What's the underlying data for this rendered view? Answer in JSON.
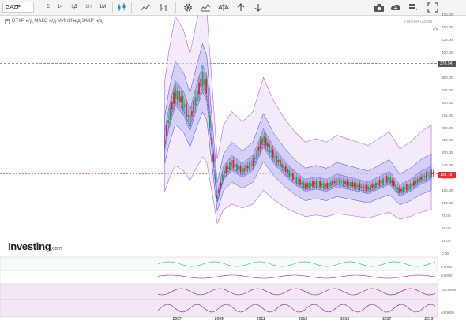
{
  "toolbar": {
    "symbol": "GAZP",
    "timeframes": [
      "5",
      "1ч",
      "1Д",
      "1Н",
      "1М"
    ],
    "active_timeframe": "1Н",
    "icons": [
      "candlestick-icon",
      "indicators-icon",
      "bar-chart-icon",
      "settings-icon",
      "area-icon",
      "balance-icon",
      "undo-icon",
      "redo-icon",
      "camera-icon",
      "cloud-save-icon",
      "grid-icon",
      "fullscreen-icon"
    ]
  },
  "legend": {
    "text": "ОТКР н/д  МАКС н/д  МИНИ н/д  ЗАКР н/д",
    "market_status": "• Market Closed"
  },
  "price_axis": {
    "ticks": [
      "475.00",
      "450.00",
      "425.00",
      "400.00",
      "375.00",
      "350.00",
      "325.00",
      "300.00",
      "275.00",
      "250.00",
      "225.00",
      "200.00",
      "175.00",
      "150.00",
      "125.00",
      "100.00",
      "75.00",
      "50.00",
      "25.00",
      "0.00"
    ],
    "reference_label": "378.54",
    "current_label": "158.79"
  },
  "indicator_axis": {
    "panel1_label": "0.0000",
    "panel2_label": "0.0000",
    "panel3_label": "100.0000",
    "panel4_label": "40.0000"
  },
  "x_axis": [
    "2007",
    "2009",
    "2011",
    "2013",
    "2015",
    "2017",
    "2019"
  ],
  "brand": {
    "name": "Investing",
    "suffix": ".com"
  },
  "colors": {
    "up": "#2e9e4d",
    "down": "#c62f2f",
    "band": "#4a4ad6",
    "envelope": "#b06ad8",
    "current": "#e03030",
    "reference_line": "#555555"
  },
  "chart_data": {
    "type": "candlestick",
    "x_range": [
      2006,
      2019.4
    ],
    "y_range": [
      0,
      475
    ],
    "reference_price": 378.54,
    "current_price": 158.79,
    "approx_close_series": [
      {
        "x": 2006.4,
        "y": 225
      },
      {
        "x": 2006.6,
        "y": 270
      },
      {
        "x": 2006.9,
        "y": 320
      },
      {
        "x": 2007.3,
        "y": 300
      },
      {
        "x": 2007.6,
        "y": 265
      },
      {
        "x": 2007.9,
        "y": 310
      },
      {
        "x": 2008.2,
        "y": 350
      },
      {
        "x": 2008.4,
        "y": 330
      },
      {
        "x": 2008.7,
        "y": 200
      },
      {
        "x": 2008.9,
        "y": 110
      },
      {
        "x": 2009.2,
        "y": 160
      },
      {
        "x": 2009.6,
        "y": 180
      },
      {
        "x": 2010.1,
        "y": 165
      },
      {
        "x": 2010.6,
        "y": 180
      },
      {
        "x": 2011.1,
        "y": 230
      },
      {
        "x": 2011.6,
        "y": 195
      },
      {
        "x": 2012.1,
        "y": 170
      },
      {
        "x": 2012.6,
        "y": 150
      },
      {
        "x": 2013.1,
        "y": 135
      },
      {
        "x": 2013.6,
        "y": 140
      },
      {
        "x": 2014.1,
        "y": 135
      },
      {
        "x": 2014.6,
        "y": 145
      },
      {
        "x": 2015.1,
        "y": 140
      },
      {
        "x": 2015.6,
        "y": 135
      },
      {
        "x": 2016.1,
        "y": 130
      },
      {
        "x": 2016.6,
        "y": 140
      },
      {
        "x": 2017.1,
        "y": 150
      },
      {
        "x": 2017.6,
        "y": 125
      },
      {
        "x": 2018.1,
        "y": 135
      },
      {
        "x": 2018.6,
        "y": 150
      },
      {
        "x": 2019.1,
        "y": 160
      }
    ]
  }
}
